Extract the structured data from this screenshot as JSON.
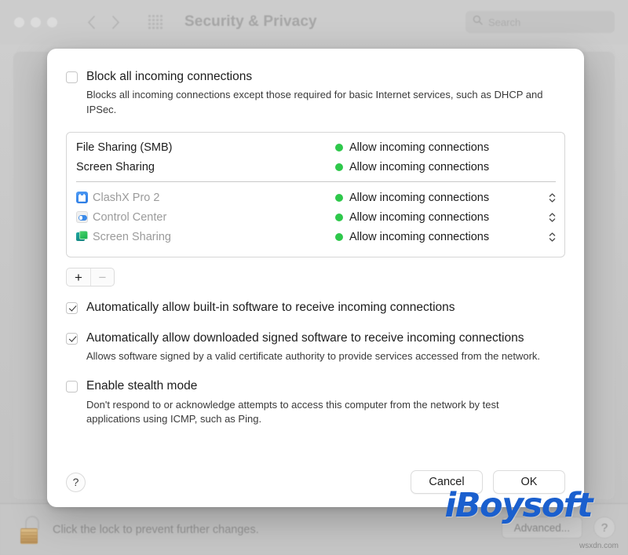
{
  "window": {
    "title": "Security & Privacy",
    "traffic_lights": [
      "close",
      "minimize",
      "zoom"
    ],
    "nav": {
      "back": "back-chevron",
      "forward": "forward-chevron"
    },
    "grid_icon": "show-all-grid-icon",
    "search": {
      "placeholder": "Search",
      "value": "",
      "icon": "search-icon"
    }
  },
  "bottom_bar": {
    "lock_icon": "unlocked-padlock-icon",
    "lock_text": "Click the lock to prevent further changes.",
    "advanced_label": "Advanced...",
    "help_label": "?"
  },
  "watermark": {
    "brand": "iBoysoft",
    "site": "wsxdn.com"
  },
  "sheet": {
    "block_all": {
      "label": "Block all incoming connections",
      "checked": false,
      "description": "Blocks all incoming connections except those required for basic Internet services, such as DHCP and IPSec."
    },
    "list": {
      "system_services": [
        {
          "name": "File Sharing (SMB)",
          "status": "Allow incoming connections",
          "status_color": "#2ec84b",
          "icon": null,
          "stepper": false,
          "dim": false
        },
        {
          "name": "Screen Sharing",
          "status": "Allow incoming connections",
          "status_color": "#2ec84b",
          "icon": null,
          "stepper": false,
          "dim": false
        }
      ],
      "applications": [
        {
          "name": "ClashX Pro 2",
          "status": "Allow incoming connections",
          "status_color": "#2ec84b",
          "icon": "clashx-pro-app-icon",
          "stepper": true,
          "dim": true
        },
        {
          "name": "Control Center",
          "status": "Allow incoming connections",
          "status_color": "#2ec84b",
          "icon": "control-center-app-icon",
          "stepper": true,
          "dim": true
        },
        {
          "name": "Screen Sharing",
          "status": "Allow incoming connections",
          "status_color": "#2ec84b",
          "icon": "screen-sharing-app-icon",
          "stepper": true,
          "dim": true
        }
      ]
    },
    "add_remove": {
      "add_label": "+",
      "remove_label": "−"
    },
    "allow_builtin": {
      "label": "Automatically allow built-in software to receive incoming connections",
      "checked": true
    },
    "allow_signed": {
      "label": "Automatically allow downloaded signed software to receive incoming connections",
      "checked": true,
      "description": "Allows software signed by a valid certificate authority to provide services accessed from the network."
    },
    "stealth": {
      "label": "Enable stealth mode",
      "checked": false,
      "description": "Don't respond to or acknowledge attempts to access this computer from the network by test applications using ICMP, such as Ping."
    },
    "footer": {
      "help_label": "?",
      "cancel_label": "Cancel",
      "ok_label": "OK"
    }
  }
}
